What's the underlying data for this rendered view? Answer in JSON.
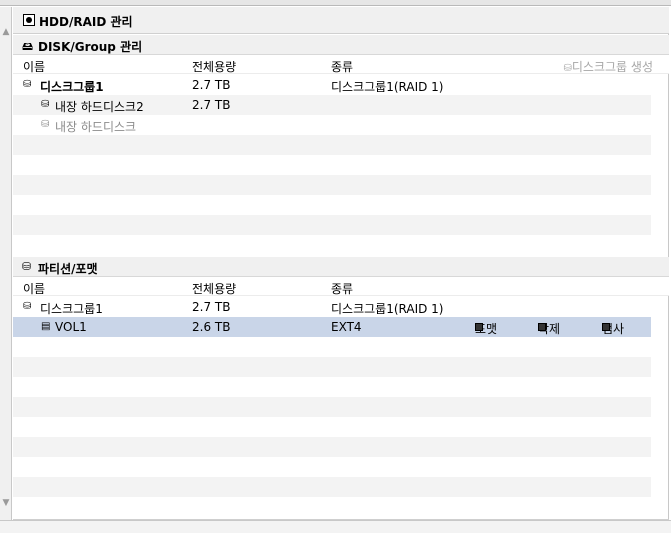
{
  "hdd_title": "HDD/RAID 관리",
  "disk_section": {
    "title": "DISK/Group 관리",
    "columns": [
      "이름",
      "전체용량",
      "종류"
    ],
    "create_label": "디스크그룹 생성",
    "rows": [
      {
        "name": "디스크그룹1",
        "capacity": "2.7 TB",
        "type": "디스크그룹1(RAID 1)"
      },
      {
        "name": "내장 하드디스크2",
        "capacity": "2.7 TB",
        "type": ""
      },
      {
        "name": "내장 하드디스크",
        "capacity": "",
        "type": ""
      }
    ]
  },
  "partition_section": {
    "title": "파티션/포맷",
    "columns": [
      "이름",
      "전체용량",
      "종류"
    ],
    "rows": [
      {
        "name": "디스크그룹1",
        "capacity": "2.7 TB",
        "type": "디스크그룹1(RAID 1)"
      },
      {
        "name": "VOL1",
        "capacity": "2.6 TB",
        "type": "EXT4"
      }
    ],
    "actions": [
      "포맷",
      "삭제",
      "검사"
    ]
  },
  "icons": {
    "hdd": "disk-icon",
    "group": "disk-group-icon",
    "disk": "disk-icon",
    "volume": "volume-icon"
  }
}
